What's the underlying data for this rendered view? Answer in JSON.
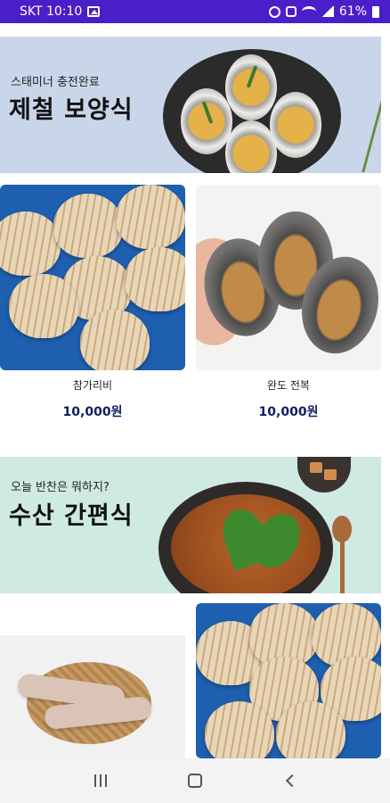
{
  "status_bar": {
    "carrier_time": "SKT 10:10",
    "battery": "61%"
  },
  "banners": [
    {
      "subtitle": "스태미너 충전완료",
      "title": "제철 보양식"
    },
    {
      "subtitle": "오늘 반찬은 뭐하지?",
      "title": "수산 간편식"
    }
  ],
  "products": [
    {
      "name": "참가리비",
      "price": "10,000원"
    },
    {
      "name": "완도 전복",
      "price": "10,000원"
    }
  ],
  "icons": {
    "status": [
      "gallery-icon",
      "alarm-icon",
      "mute-icon",
      "wifi-icon",
      "signal-icon",
      "battery-icon"
    ],
    "navigation": [
      "recents-icon",
      "home-icon",
      "back-icon"
    ]
  }
}
